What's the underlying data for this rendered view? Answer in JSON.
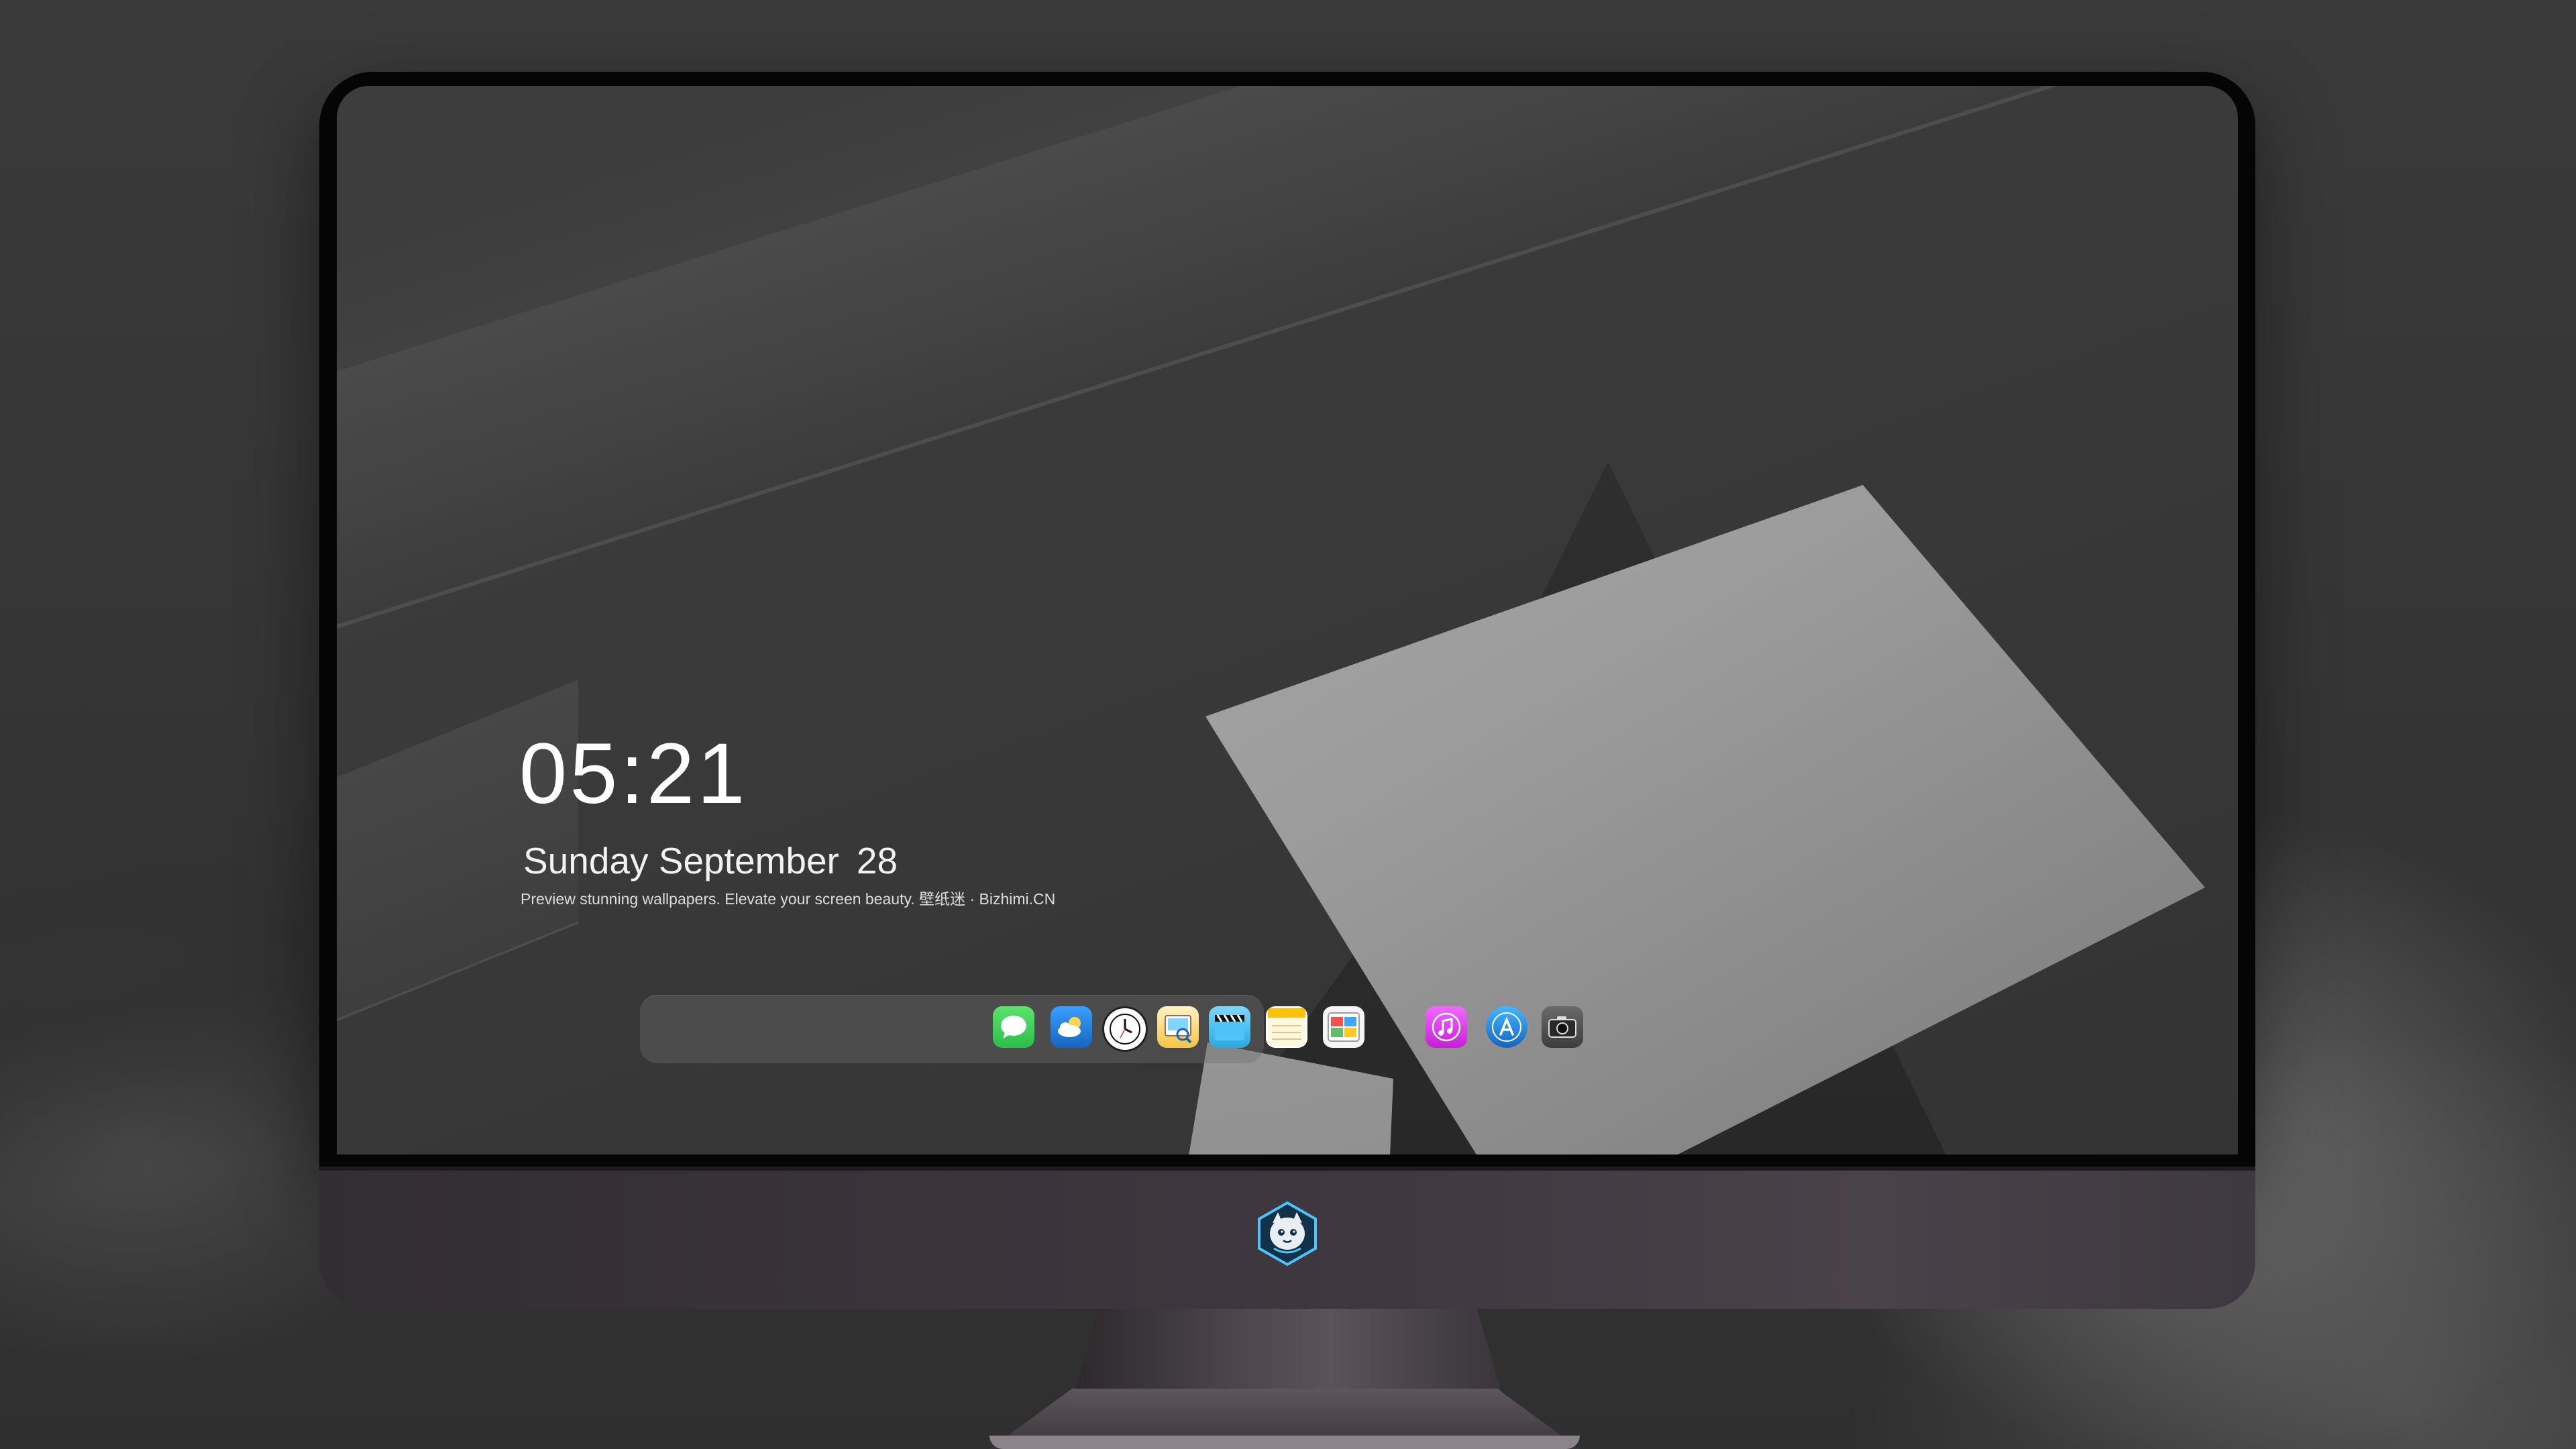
{
  "lock_screen": {
    "time": "05:21",
    "weekday_month": "Sunday September",
    "day": "28",
    "tagline": "Preview stunning wallpapers. Elevate your screen beauty. 壁纸迷 · Bizhimi.CN"
  },
  "dock": {
    "apps": [
      {
        "name": "messages-icon",
        "color": "#34c759"
      },
      {
        "name": "weather-icon",
        "color": "#1e88e5"
      },
      {
        "name": "clock-icon",
        "color": "#111111"
      },
      {
        "name": "preview-icon",
        "color": "#f5c542"
      },
      {
        "name": "clapper-icon",
        "color": "#33b5e5"
      },
      {
        "name": "notes-icon",
        "color": "#ffd54f"
      },
      {
        "name": "photo-editor-icon",
        "color": "#4caf50"
      },
      {
        "name": "music-icon",
        "color": "#e040fb"
      },
      {
        "name": "app-store-icon",
        "color": "#1e88e5"
      },
      {
        "name": "camera-icon",
        "color": "#555555"
      }
    ]
  },
  "monitor": {
    "logo": "mascot-logo-icon"
  }
}
